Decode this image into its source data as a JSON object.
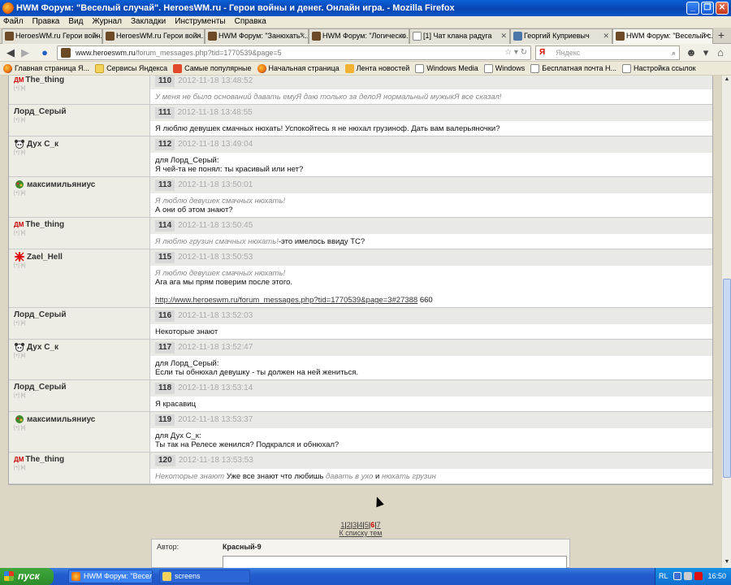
{
  "window": {
    "title": "HWM Форум: \"Веселый случай\". HeroesWM.ru - Герои войны и денег. Онлайн игра. - Mozilla Firefox"
  },
  "menu": [
    "Файл",
    "Правка",
    "Вид",
    "Журнал",
    "Закладки",
    "Инструменты",
    "Справка"
  ],
  "tabs": [
    {
      "label": "HeroesWM.ru Герои войн...",
      "icon": "hwm-icon",
      "active": false
    },
    {
      "label": "HeroesWM.ru Герои войн...",
      "icon": "hwm-icon",
      "active": false
    },
    {
      "label": "HWM Форум: \"Занюхать\"...",
      "icon": "hwm-icon",
      "active": false
    },
    {
      "label": "HWM Форум: \"Логическо...",
      "icon": "hwm-icon",
      "active": false
    },
    {
      "label": "[1] Чат клана радуга",
      "icon": "blank-page-icon",
      "active": false
    },
    {
      "label": "Георгий Куприевыч",
      "icon": "vk-icon",
      "active": false
    },
    {
      "label": "HWM Форум: \"Веселый с...",
      "icon": "hwm-icon",
      "active": true
    }
  ],
  "address": {
    "host": "www.heroeswm.ru",
    "path": "/forum_messages.php?tid=1770539&page=5"
  },
  "search": {
    "placeholder": "Яндекс",
    "logo": "Я"
  },
  "bookmarks": [
    {
      "label": "Главная страница Я...",
      "icon": "firefox-icon"
    },
    {
      "label": "Сервисы Яндекса",
      "icon": "folder-icon"
    },
    {
      "label": "Самые популярные",
      "icon": "yandex-icon"
    },
    {
      "label": "Начальная страница",
      "icon": "firefox-icon"
    },
    {
      "label": "Лента новостей",
      "icon": "news-icon"
    },
    {
      "label": "Windows Media",
      "icon": "page-icon"
    },
    {
      "label": "Windows",
      "icon": "page-icon"
    },
    {
      "label": "Бесплатная почта Н...",
      "icon": "page-icon"
    },
    {
      "label": "Настройка ссылок",
      "icon": "page-icon"
    }
  ],
  "author_sub": "[+] [к]",
  "posts": [
    {
      "author": "The_thing",
      "clan": "ДМ",
      "avatar": "clan-dm-icon",
      "num": "110",
      "time": "2012-11-18 13:48:52",
      "lines": [
        {
          "quote": "У меня не было оснований давать емуЯ даю только за делоЯ нормальный мужыкЯ все сказал!",
          "text": ""
        }
      ]
    },
    {
      "author": "Лорд_Серый",
      "clan": "",
      "avatar": "",
      "num": "111",
      "time": "2012-11-18 13:48:55",
      "lines": [
        {
          "quote": "",
          "text": "Я люблю девушек смачных нюхать! Успокойтесь я не нюхал грузиноф. Дать вам валерьяночки?"
        }
      ]
    },
    {
      "author": "Дух С_к",
      "clan": "",
      "avatar": "panda-avatar-icon",
      "num": "112",
      "time": "2012-11-18 13:49:04",
      "lines": [
        {
          "quote": "",
          "text": "для Лорд_Серый:"
        },
        {
          "quote": "",
          "text": "Я чей-та не понял: ты красивый или нет?"
        }
      ]
    },
    {
      "author": "максимильяниус",
      "clan": "",
      "avatar": "green-avatar-icon",
      "num": "113",
      "time": "2012-11-18 13:50:01",
      "lines": [
        {
          "quote": "Я люблю девушек смачных нюхать!",
          "text": ""
        },
        {
          "quote": "",
          "text": "А они об этом знают?"
        }
      ]
    },
    {
      "author": "The_thing",
      "clan": "ДМ",
      "avatar": "clan-dm-icon",
      "num": "114",
      "time": "2012-11-18 13:50:45",
      "lines": [
        {
          "quote": "Я люблю грузин смачных нюхать!",
          "text": "-это имелось ввиду ТС?"
        }
      ]
    },
    {
      "author": "Zael_Hell",
      "clan": "",
      "avatar": "red-star-icon",
      "num": "115",
      "time": "2012-11-18 13:50:53",
      "lines": [
        {
          "quote": "Я люблю девушек смачных нюхать!",
          "text": ""
        },
        {
          "quote": "",
          "text": "Ага ага мы прям поверим после этого."
        },
        {
          "quote": "",
          "text": " "
        },
        {
          "quote": "",
          "text": "",
          "link": "http://www.heroeswm.ru/forum_messages.php?tid=1770539&page=3#27388",
          "after": " 660"
        }
      ]
    },
    {
      "author": "Лорд_Серый",
      "clan": "",
      "avatar": "",
      "num": "116",
      "time": "2012-11-18 13:52:03",
      "lines": [
        {
          "quote": "",
          "text": "Некоторые знают"
        }
      ]
    },
    {
      "author": "Дух С_к",
      "clan": "",
      "avatar": "panda-avatar-icon",
      "num": "117",
      "time": "2012-11-18 13:52:47",
      "lines": [
        {
          "quote": "",
          "text": "для Лорд_Серый:"
        },
        {
          "quote": "",
          "text": "Если ты обнюхал девушку - ты должен на ней жениться."
        }
      ]
    },
    {
      "author": "Лорд_Серый",
      "clan": "",
      "avatar": "",
      "num": "118",
      "time": "2012-11-18 13:53:14",
      "lines": [
        {
          "quote": "",
          "text": "Я красавиц"
        }
      ]
    },
    {
      "author": "максимильяниус",
      "clan": "",
      "avatar": "green-avatar-icon",
      "num": "119",
      "time": "2012-11-18 13:53:37",
      "lines": [
        {
          "quote": "",
          "text": "для Дух С_к:"
        },
        {
          "quote": "",
          "text": "Ты так на Релесе женился? Подкрался и обнюхал?"
        }
      ]
    },
    {
      "author": "The_thing",
      "clan": "ДМ",
      "avatar": "clan-dm-icon",
      "num": "120",
      "time": "2012-11-18 13:53:53",
      "lines": [
        {
          "mixed": [
            [
              "q",
              "Некоторые знают"
            ],
            [
              "t",
              " Уже все знают что любишь "
            ],
            [
              "q",
              "давать в ухо"
            ],
            [
              "t",
              " и "
            ],
            [
              "q",
              "нюхать грузин"
            ]
          ]
        }
      ]
    }
  ],
  "pager": {
    "pages": [
      "1",
      "2",
      "3",
      "4",
      "5",
      "6",
      "7"
    ],
    "current": "6",
    "back": "К списку тем"
  },
  "reply": {
    "author_label": "Автор:",
    "author_value": "Красный-9"
  },
  "taskbar": {
    "start": "пуск",
    "tasks": [
      {
        "label": "HWM Форум: \"Весел...",
        "icon": "firefox-icon"
      },
      {
        "label": "screens",
        "icon": "folder-icon"
      }
    ],
    "lang": "RL",
    "clock": "16:50"
  }
}
